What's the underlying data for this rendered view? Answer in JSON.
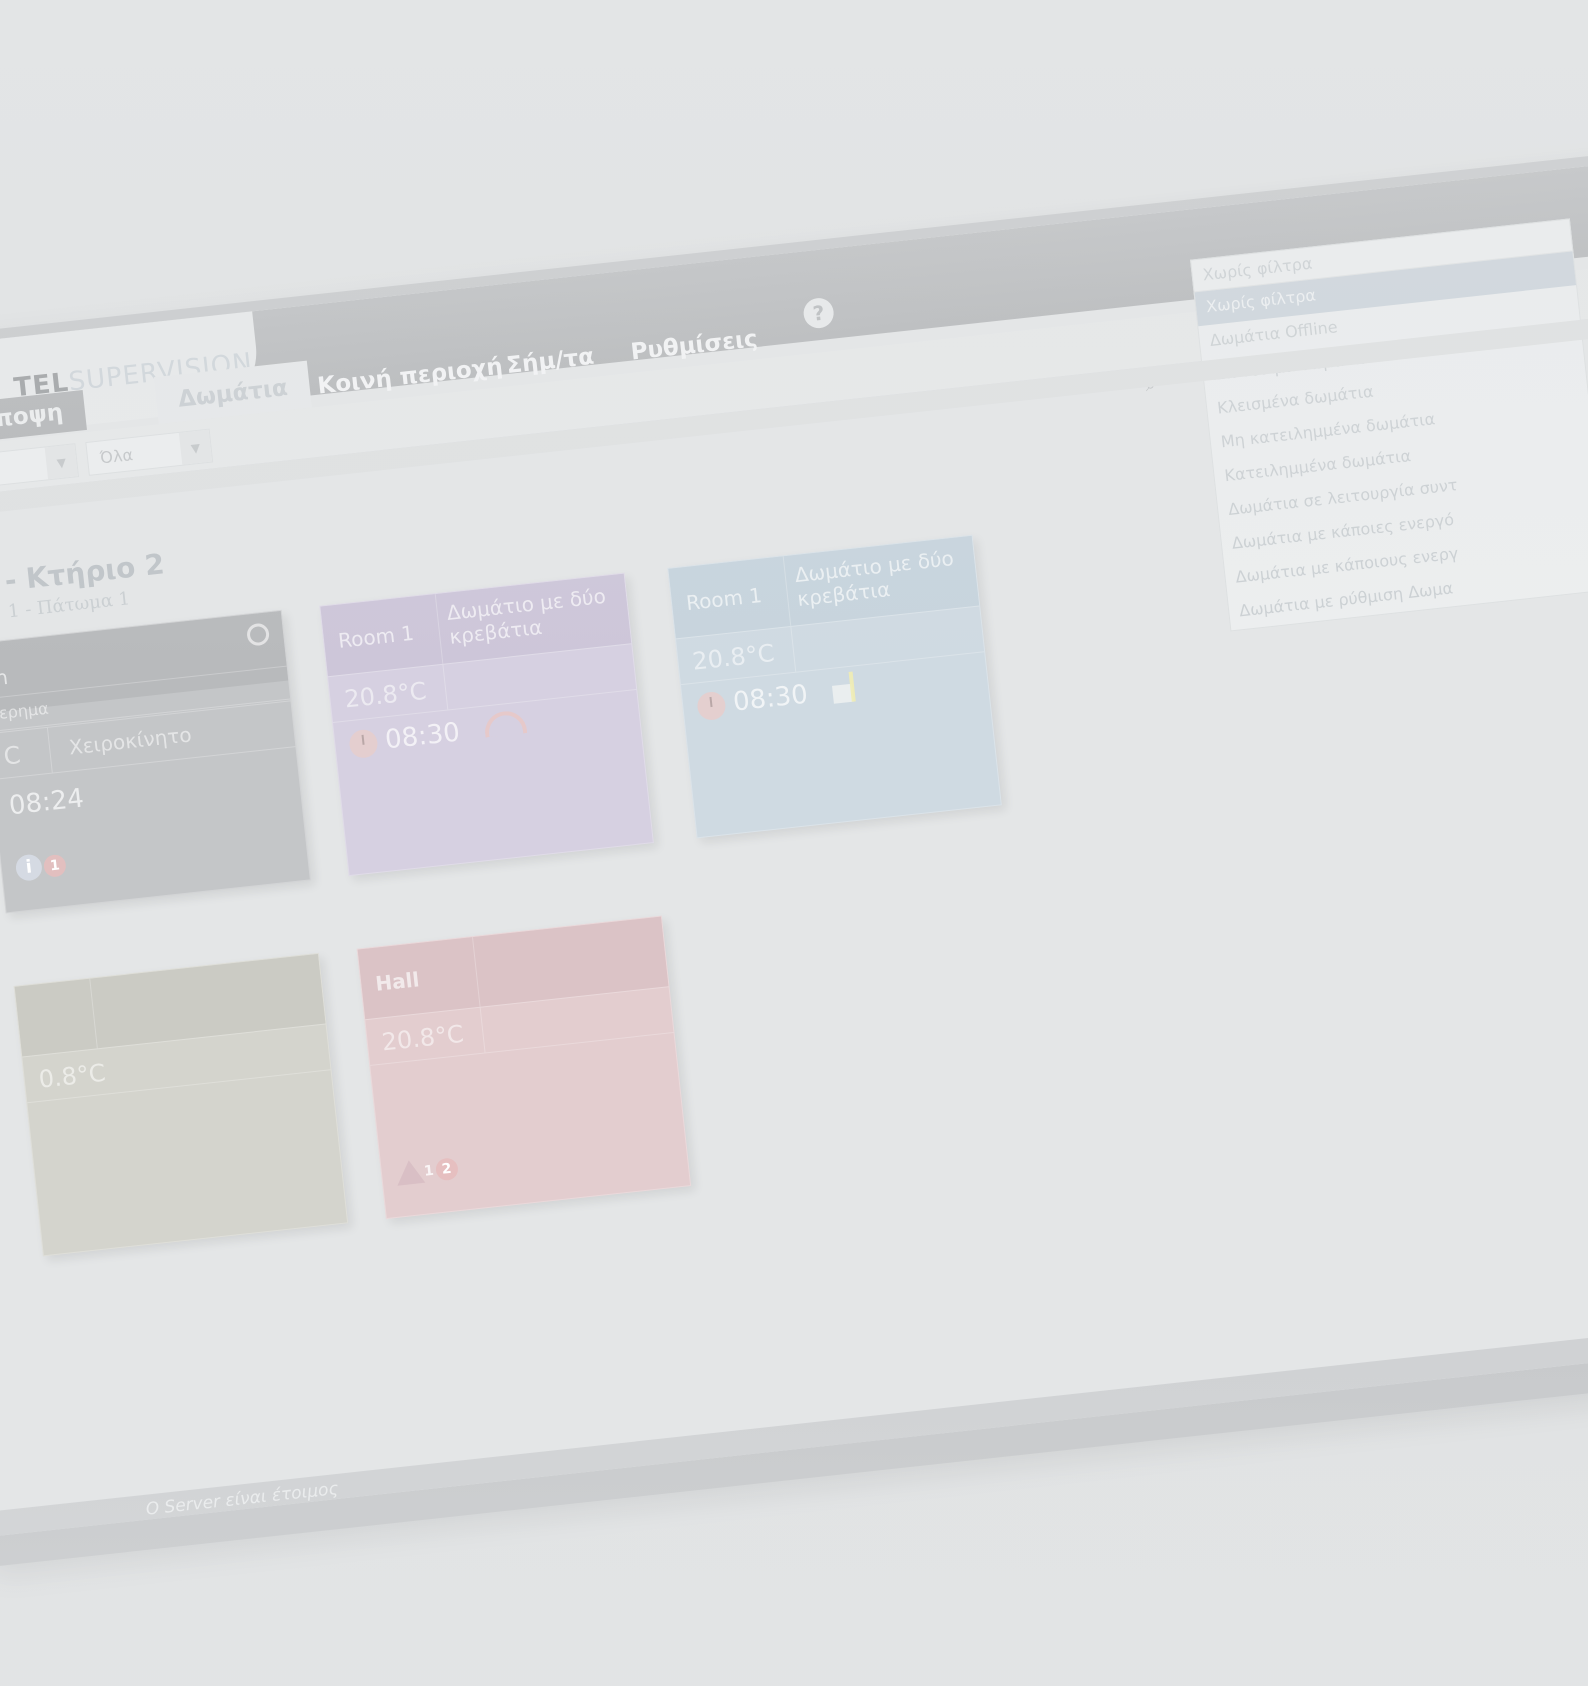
{
  "app": {
    "logo_part1": "TEL",
    "logo_part2": "SUPERVISION"
  },
  "tabs": [
    {
      "label": "ική άποψη"
    },
    {
      "label": "Δωμάτια"
    },
    {
      "label": "Κοινή περιοχή"
    },
    {
      "label": "Σήμ/τα"
    },
    {
      "label": "Ρυθμίσεις"
    }
  ],
  "help": {
    "label": "?"
  },
  "filters": {
    "select1_value": "",
    "select2_value": "Όλα"
  },
  "dropdown": {
    "current": "Χωρίς φίλτρα",
    "options": [
      "Χωρίς φίλτρα",
      "Δωμάτια Offline",
      "Διαθέσιμα δωμάτια",
      "Κλεισμένα δωμάτια",
      "Μη κατειλημμένα δωμάτια",
      "Κατειλημμένα δωμάτια",
      "Δωμάτια σε λειτουργία συντ",
      "Δωμάτια με κάποιες ενεργό",
      "Δωμάτια με κάποιους ενεργ",
      "Δωμάτια με ρύθμιση Δωμα"
    ]
  },
  "floor": {
    "title": "- Κτήριο 2",
    "subtitle": "1 - Πάτωμα 1"
  },
  "cards": [
    {
      "name": "n",
      "type": "ερημα",
      "temp": "C",
      "extra": "Χειροκίνητο",
      "time": "08:24",
      "badge": "1"
    },
    {
      "name": "Room 1",
      "type": "Δωμάτιο με δύο κρεβάτια",
      "temp": "20.8°C",
      "time": "08:30"
    },
    {
      "name": "Room 1",
      "type": "Δωμάτιο με δύο κρεβάτια",
      "temp": "20.8°C",
      "time": "08:30"
    },
    {
      "name": "",
      "type": "",
      "temp": "0.8°C"
    },
    {
      "name": "Hall",
      "type": "",
      "temp": "20.8°C",
      "warn_count": "1",
      "badge": "2"
    }
  ],
  "status": {
    "text": "Ο Server είναι έτοιμος"
  },
  "colors": {
    "card_gray": "#c4c6c8",
    "card_purple": "#d5cfe0",
    "card_blue": "#cfdbe2",
    "card_olive": "#d3d3cc",
    "card_red": "#e2ccce"
  }
}
